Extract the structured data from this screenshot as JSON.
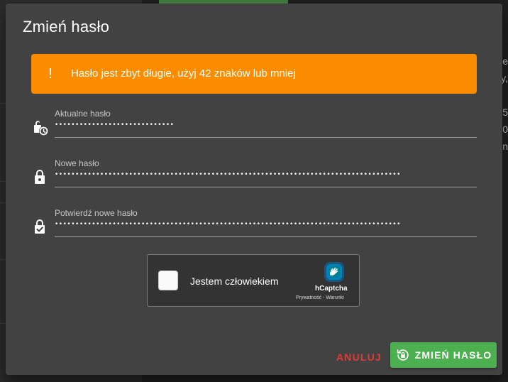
{
  "background": {
    "tab_label": "",
    "right_fragments": [
      "e",
      "y,",
      "5",
      "0",
      "n"
    ]
  },
  "dialog": {
    "title": "Zmień hasło",
    "alert": {
      "icon": "exclamation-icon",
      "message": "Hasło jest zbyt długie, użyj 42 znaków lub mniej",
      "color": "#fb8c00"
    },
    "fields": {
      "current_password": {
        "label": "Aktualne hasło",
        "value": "•••••••••••••••••••••••••••••",
        "icon": "lock-clock-icon"
      },
      "new_password": {
        "label": "Nowe hasło",
        "value": "••••••••••••••••••••••••••••••••••••••••••••••••••••••••••••••••••••••••••••••••••••",
        "icon": "lock-icon"
      },
      "confirm_password": {
        "label": "Potwierdź nowe hasło",
        "value": "••••••••••••••••••••••••••••••••••••••••••••••••••••••••••••••••••••••••••••••••••••",
        "icon": "lock-check-icon"
      }
    },
    "captcha": {
      "label": "Jestem człowiekiem",
      "brand": "hCaptcha",
      "links": "Prywatność - Warunki"
    },
    "buttons": {
      "cancel": "ANULUJ",
      "submit": "ZMIEŃ HASŁO",
      "cancel_color": "#e53935",
      "submit_color": "#4caf50"
    }
  }
}
